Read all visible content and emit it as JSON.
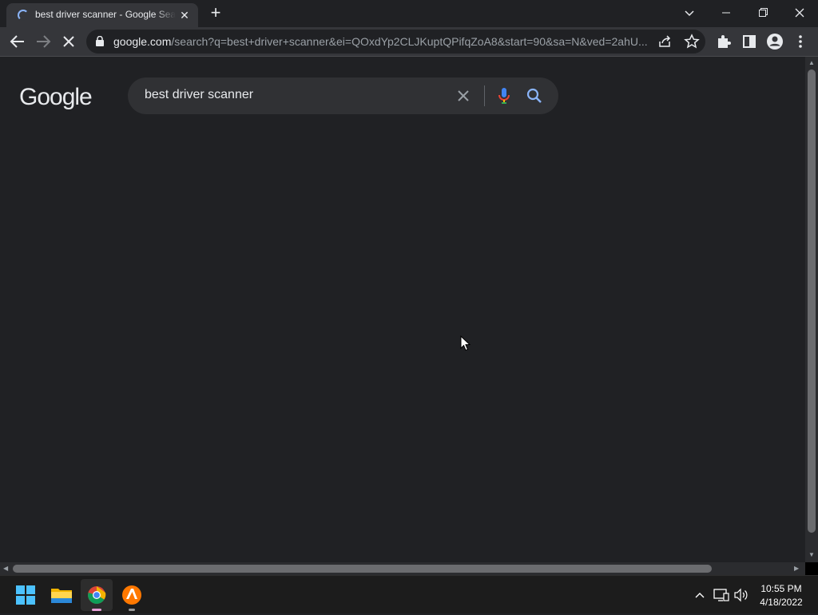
{
  "browser": {
    "tab_title": "best driver scanner - Google Search",
    "tab_close_glyph": "✕",
    "new_tab_glyph": "+",
    "url_domain": "google.com",
    "url_rest": "/search?q=best+driver+scanner&ei=QOxdYp2CLJKuptQPifqZoA8&start=90&sa=N&ved=2ahU...",
    "window_buttons": [
      "tab-search-icon",
      "minimize-icon",
      "restore-icon",
      "close-icon"
    ],
    "toolbar_icons": [
      "back-icon",
      "forward-icon",
      "stop-loading-icon",
      "lock-icon",
      "share-icon",
      "star-icon",
      "extensions-icon",
      "side-panel-icon",
      "profile-icon",
      "menu-icon"
    ]
  },
  "page": {
    "logo_text": "Google",
    "search_query": "best driver scanner",
    "search_icons": [
      "clear-icon",
      "mic-icon",
      "search-icon"
    ]
  },
  "taskbar": {
    "apps": [
      "windows-start-icon",
      "file-explorer-icon",
      "chrome-icon",
      "avast-icon"
    ],
    "tray_icons": [
      "chevron-up-icon",
      "network-icon",
      "volume-icon"
    ],
    "time": "10:55 PM",
    "date": "4/18/2022"
  },
  "colors": {
    "background": "#202124",
    "toolbar": "#35363a",
    "searchbox": "#303134",
    "accent_blue": "#8ab4f8"
  }
}
